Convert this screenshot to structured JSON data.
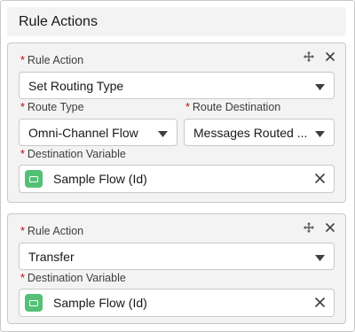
{
  "panel": {
    "title": "Rule Actions"
  },
  "required_marker": "*",
  "cards": [
    {
      "rule_action": {
        "label": "Rule Action",
        "value": "Set Routing Type"
      },
      "route_type": {
        "label": "Route Type",
        "value": "Omni-Channel Flow"
      },
      "route_destination": {
        "label": "Route Destination",
        "value": "Messages Routed ..."
      },
      "destination_variable": {
        "label": "Destination Variable",
        "value": "Sample Flow (Id)"
      }
    },
    {
      "rule_action": {
        "label": "Rule Action",
        "value": "Transfer"
      },
      "destination_variable": {
        "label": "Destination Variable",
        "value": "Sample Flow (Id)"
      }
    }
  ],
  "icons": {
    "move": "move-icon",
    "close": "close-icon",
    "caret": "chevron-down-icon",
    "flow": "flow-icon",
    "clear": "clear-icon"
  },
  "colors": {
    "required": "#ba0517",
    "flow_icon": "#54c076",
    "card_bg": "#f3f3f3",
    "border": "#c9c9c9"
  }
}
